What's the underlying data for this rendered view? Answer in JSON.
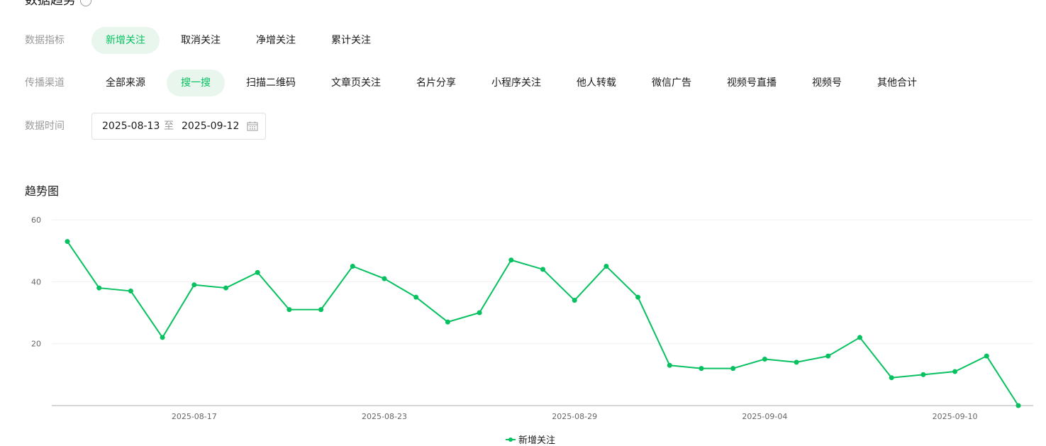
{
  "section": {
    "title": "数据趋势"
  },
  "metrics": {
    "label": "数据指标",
    "items": [
      "新增关注",
      "取消关注",
      "净增关注",
      "累计关注"
    ],
    "active": 0
  },
  "channels": {
    "label": "传播渠道",
    "items": [
      "全部来源",
      "搜一搜",
      "扫描二维码",
      "文章页关注",
      "名片分享",
      "小程序关注",
      "他人转载",
      "微信广告",
      "视频号直播",
      "视频号",
      "其他合计"
    ],
    "active": 1
  },
  "date": {
    "label": "数据时间",
    "start": "2025-08-13",
    "separator": "至",
    "end": "2025-09-12"
  },
  "chart": {
    "title": "趋势图"
  },
  "colors": {
    "accent": "#07c160",
    "accent_bg": "#e8f6ee"
  },
  "chart_data": {
    "type": "line",
    "x": [
      "2025-08-13",
      "2025-08-14",
      "2025-08-15",
      "2025-08-16",
      "2025-08-17",
      "2025-08-18",
      "2025-08-19",
      "2025-08-20",
      "2025-08-21",
      "2025-08-22",
      "2025-08-23",
      "2025-08-24",
      "2025-08-25",
      "2025-08-26",
      "2025-08-27",
      "2025-08-28",
      "2025-08-29",
      "2025-08-30",
      "2025-08-31",
      "2025-09-01",
      "2025-09-02",
      "2025-09-03",
      "2025-09-04",
      "2025-09-05",
      "2025-09-06",
      "2025-09-07",
      "2025-09-08",
      "2025-09-09",
      "2025-09-10",
      "2025-09-11",
      "2025-09-12"
    ],
    "series": [
      {
        "name": "新增关注",
        "values": [
          53,
          38,
          37,
          22,
          39,
          38,
          43,
          31,
          31,
          45,
          41,
          35,
          27,
          30,
          47,
          44,
          34,
          45,
          35,
          13,
          12,
          12,
          15,
          14,
          16,
          22,
          9,
          10,
          11,
          16,
          0
        ]
      }
    ],
    "xticks": [
      "2025-08-17",
      "2025-08-23",
      "2025-08-29",
      "2025-09-04",
      "2025-09-10"
    ],
    "yticks": [
      20,
      40,
      60
    ],
    "ylim": [
      0,
      60
    ],
    "grid": true,
    "legend": "bottom"
  }
}
